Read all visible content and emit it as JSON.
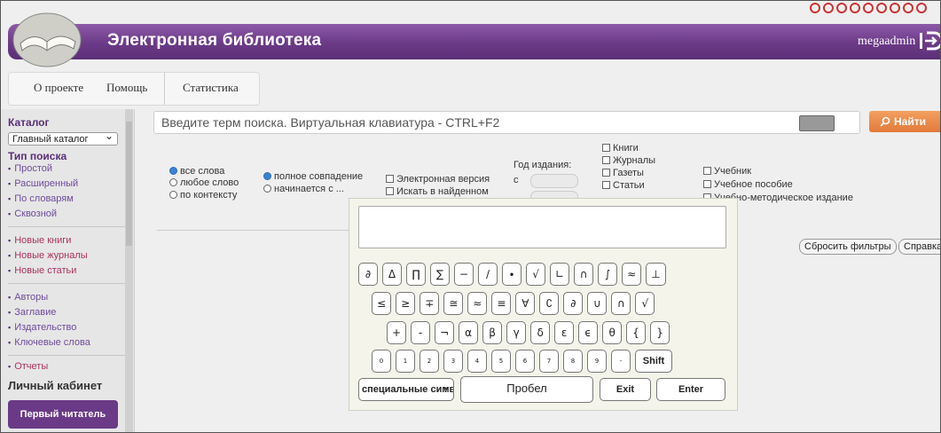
{
  "header": {
    "title": "Электронная библиотека",
    "user": "megaadmin"
  },
  "nav": {
    "items": [
      "О проекте",
      "Помощь",
      "Статистика"
    ]
  },
  "sidebar": {
    "catalog_title": "Каталог",
    "catalog_select": "Главный каталог",
    "search_type_title": "Тип поиска",
    "search_types": [
      "Простой",
      "Расширенный",
      "По словарям",
      "Сквозной"
    ],
    "new_items": [
      "Новые книги",
      "Новые журналы",
      "Новые статьи"
    ],
    "browse": [
      "Авторы",
      "Заглавие",
      "Издательство",
      "Ключевые слова"
    ],
    "reports": "Отчеты",
    "cabinet_title": "Личный кабинет",
    "first_reader_button": "Первый читатель"
  },
  "search": {
    "placeholder": "Введите терм поиска. Виртуальная клавиатура - CTRL+F2",
    "find_button": "Найти"
  },
  "filters": {
    "word_mode": [
      "все слова",
      "любое слово",
      "по контексту"
    ],
    "match_mode": [
      "полное совпадение",
      "начинается с ..."
    ],
    "electronic_version": "Электронная версия",
    "search_in_found": "Искать в найденном",
    "year_label": "Год издания:",
    "year_from_label": "с",
    "doc_types": [
      "Книги",
      "Журналы",
      "Газеты",
      "Статьи"
    ],
    "edu_types": [
      "Учебник",
      "Учебное пособие",
      "Учебно-методическое издание"
    ],
    "reset_button": "Сбросить фильтры",
    "help_button": "Справка"
  },
  "keyboard": {
    "row1": [
      "∂",
      "Δ",
      "∏",
      "∑",
      "−",
      "∕",
      "∙",
      "√",
      "∟",
      "∩",
      "∫",
      "≈",
      "⊥"
    ],
    "row2": [
      "≤",
      "≥",
      "∓",
      "≅",
      "≈",
      "≡",
      "∀",
      "∁",
      "∂",
      "∪",
      "∩",
      "√"
    ],
    "row3": [
      "+",
      "-",
      "¬",
      "α",
      "β",
      "γ",
      "δ",
      "ε",
      "ϵ",
      "θ",
      "{",
      "}"
    ],
    "row4": [
      "0",
      "1",
      "2",
      "3",
      "4",
      "5",
      "6",
      "7",
      "8",
      "9",
      "-"
    ],
    "shift": "Shift",
    "special_select": "специальные символы",
    "space": "Пробел",
    "exit": "Exit",
    "enter": "Enter"
  }
}
